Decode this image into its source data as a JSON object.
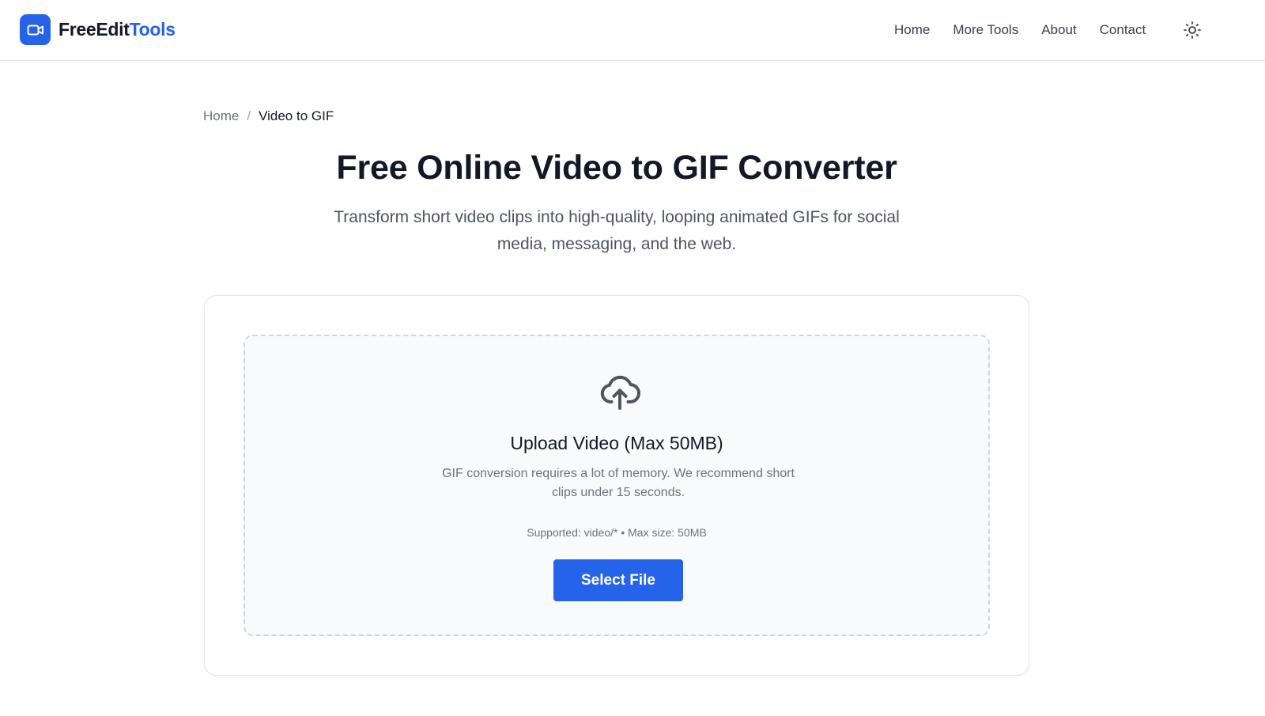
{
  "header": {
    "brand_part1": "FreeEdit",
    "brand_part2": "Tools",
    "brand_color": "#2563eb",
    "logo_icon": "video-camera-icon",
    "nav": [
      {
        "label": "Home"
      },
      {
        "label": "More Tools"
      },
      {
        "label": "About"
      },
      {
        "label": "Contact"
      }
    ],
    "theme_toggle_icon": "sun-icon"
  },
  "breadcrumb": {
    "home": "Home",
    "separator": "/",
    "current": "Video to GIF"
  },
  "hero": {
    "title": "Free Online Video to GIF Converter",
    "subtitle": "Transform short video clips into high-quality, looping animated GIFs for social media, messaging, and the web."
  },
  "upload": {
    "icon": "cloud-upload-icon",
    "title": "Upload Video (Max 50MB)",
    "description": "GIF conversion requires a lot of memory. We recommend short clips under 15 seconds.",
    "supported": "Supported: video/* • Max size: 50MB",
    "button_label": "Select File"
  }
}
